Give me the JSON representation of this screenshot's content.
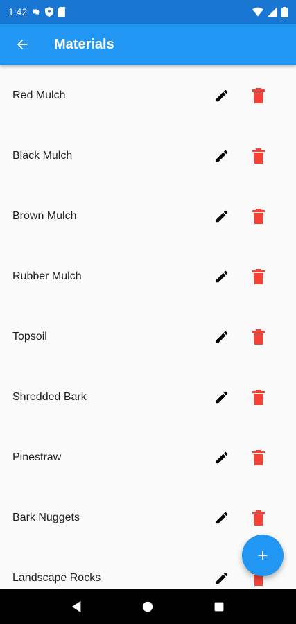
{
  "status_bar": {
    "time": "1:42",
    "icons": [
      "settings-icon",
      "shield-icon",
      "sd-card-icon",
      "wifi-icon",
      "signal-icon",
      "battery-icon"
    ]
  },
  "app_bar": {
    "title": "Materials",
    "back_icon": "arrow-back-icon",
    "color": "#2196f3"
  },
  "materials": [
    {
      "label": "Red Mulch"
    },
    {
      "label": "Black Mulch"
    },
    {
      "label": "Brown Mulch"
    },
    {
      "label": "Rubber Mulch"
    },
    {
      "label": "Topsoil"
    },
    {
      "label": "Shredded Bark"
    },
    {
      "label": "Pinestraw"
    },
    {
      "label": "Bark Nuggets"
    },
    {
      "label": "Landscape Rocks"
    }
  ],
  "row_actions": {
    "edit_icon": "pencil-icon",
    "delete_icon": "trash-icon",
    "delete_color": "#f44336"
  },
  "fab": {
    "icon": "plus-icon",
    "color": "#2196f3"
  },
  "nav_bar": {
    "icons": [
      "back-triangle-icon",
      "home-circle-icon",
      "recents-square-icon"
    ]
  }
}
